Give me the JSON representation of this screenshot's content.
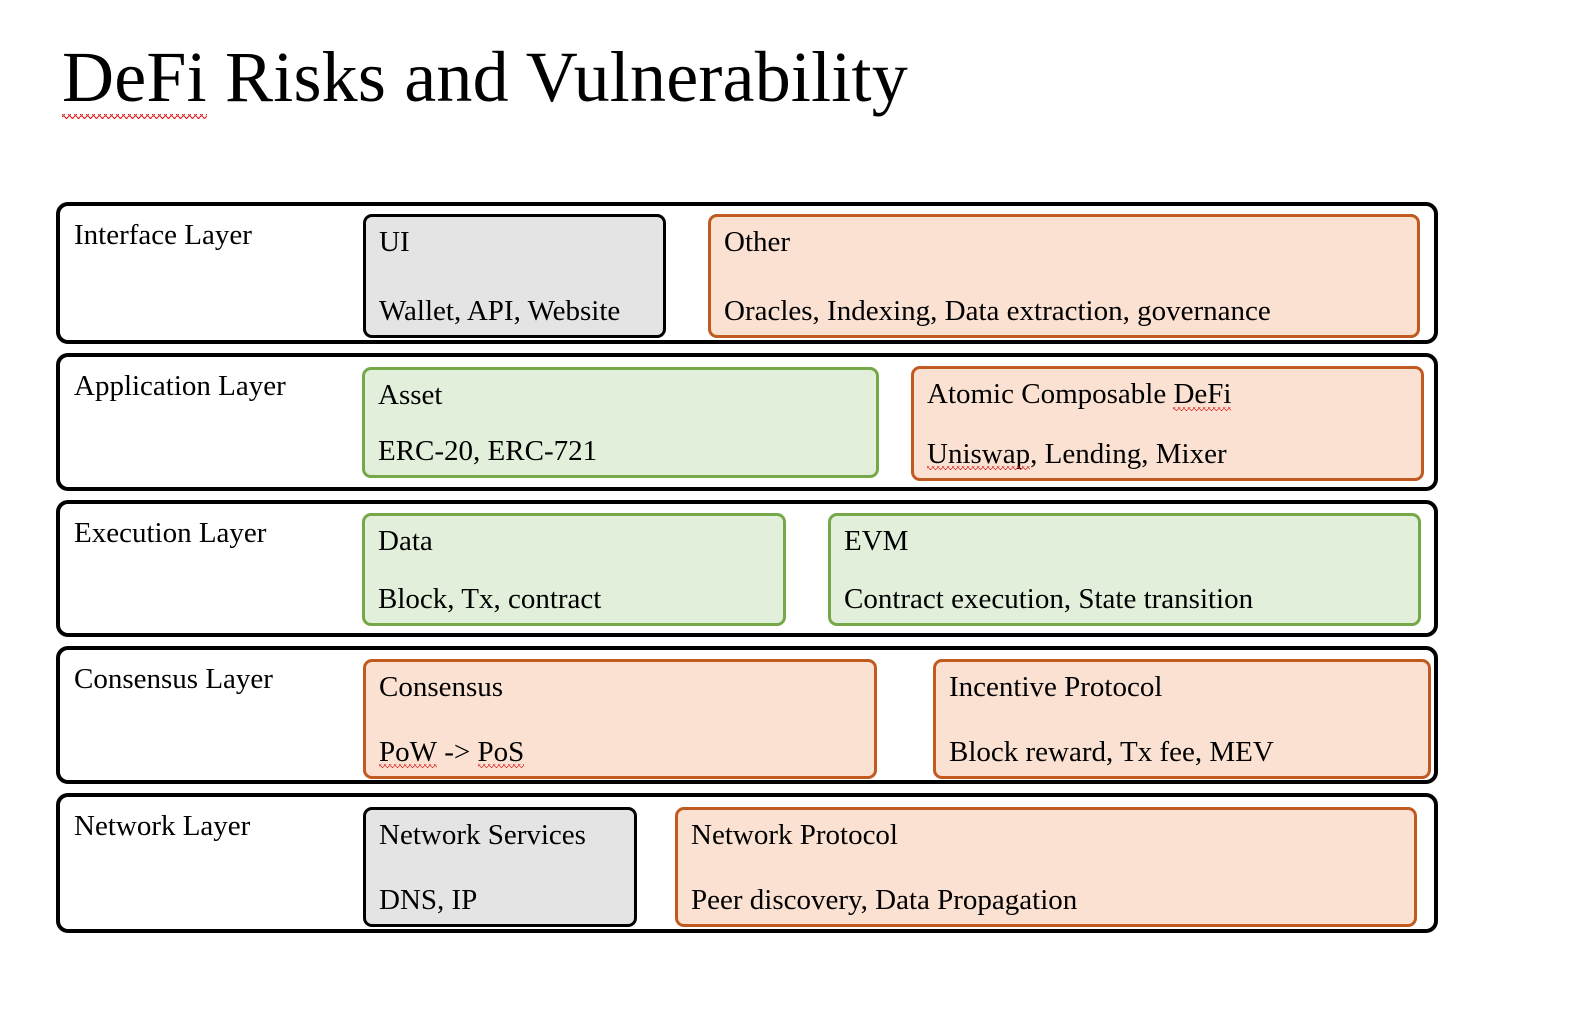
{
  "title": {
    "full": "DeFi Risks and Vulnerability",
    "misspelled_word": "DeFi",
    "rest": " Risks and Vulnerability"
  },
  "diagram_data": {
    "type": "layered-stack",
    "layer_count": 5,
    "palette": {
      "gray_fill": "#e4e4e4",
      "gray_border": "#000000",
      "peach_fill": "#fbe1d2",
      "peach_border": "#c05a21",
      "green_fill": "#e2efda",
      "green_border": "#76a849",
      "outer_border": "#000000",
      "page_background": "#ffffff",
      "spellcheck_underline": "#e02b2b"
    },
    "layers": [
      {
        "name": "Interface Layer",
        "nodes": [
          {
            "title": "UI",
            "subtitle": "Wallet, API, Website",
            "style": "gray"
          },
          {
            "title": "Other",
            "subtitle": "Oracles, Indexing, Data extraction, governance",
            "style": "peach"
          }
        ]
      },
      {
        "name": "Application Layer",
        "nodes": [
          {
            "title": "Asset",
            "subtitle": "ERC-20, ERC-721",
            "style": "green"
          },
          {
            "title": "Atomic Composable DeFi",
            "subtitle": "Uniswap, Lending, Mixer",
            "style": "peach"
          }
        ]
      },
      {
        "name": "Execution Layer",
        "nodes": [
          {
            "title": "Data",
            "subtitle": "Block, Tx, contract",
            "style": "green"
          },
          {
            "title": "EVM",
            "subtitle": "Contract execution, State transition",
            "style": "green"
          }
        ]
      },
      {
        "name": "Consensus Layer",
        "nodes": [
          {
            "title": "Consensus",
            "subtitle": "PoW -> PoS",
            "style": "peach"
          },
          {
            "title": "Incentive Protocol",
            "subtitle": "Block reward, Tx fee, MEV",
            "style": "peach"
          }
        ]
      },
      {
        "name": "Network Layer",
        "nodes": [
          {
            "title": "Network Services",
            "subtitle": "DNS, IP",
            "style": "gray"
          },
          {
            "title": "Network Protocol",
            "subtitle": "Peer discovery, Data Propagation",
            "style": "peach"
          }
        ]
      }
    ]
  },
  "layers": {
    "interface": {
      "name": "Interface Layer",
      "ui": {
        "title": "UI",
        "subtitle": "Wallet, API, Website"
      },
      "other": {
        "title": "Other",
        "subtitle": "Oracles, Indexing, Data extraction, governance"
      }
    },
    "application": {
      "name": "Application Layer",
      "asset": {
        "title": "Asset",
        "subtitle": "ERC-20, ERC-721"
      },
      "atomic": {
        "title_pre": "Atomic Composable ",
        "title_misspelled": "DeFi",
        "subtitle_misspelled": "Uniswap",
        "subtitle_rest": ", Lending, Mixer"
      }
    },
    "execution": {
      "name": "Execution Layer",
      "data": {
        "title": "Data",
        "subtitle": "Block, Tx, contract"
      },
      "evm": {
        "title": "EVM",
        "subtitle": "Contract execution, State transition"
      }
    },
    "consensus": {
      "name": "Consensus Layer",
      "consensus": {
        "title": "Consensus",
        "sub_a": "PoW",
        "sub_mid": " -> ",
        "sub_b": "PoS"
      },
      "incentive": {
        "title": "Incentive Protocol",
        "subtitle": "Block reward, Tx fee, MEV"
      }
    },
    "network": {
      "name": "Network Layer",
      "services": {
        "title": "Network Services",
        "subtitle": "DNS, IP"
      },
      "protocol": {
        "title": "Network Protocol",
        "subtitle": "Peer discovery, Data Propagation"
      }
    }
  }
}
